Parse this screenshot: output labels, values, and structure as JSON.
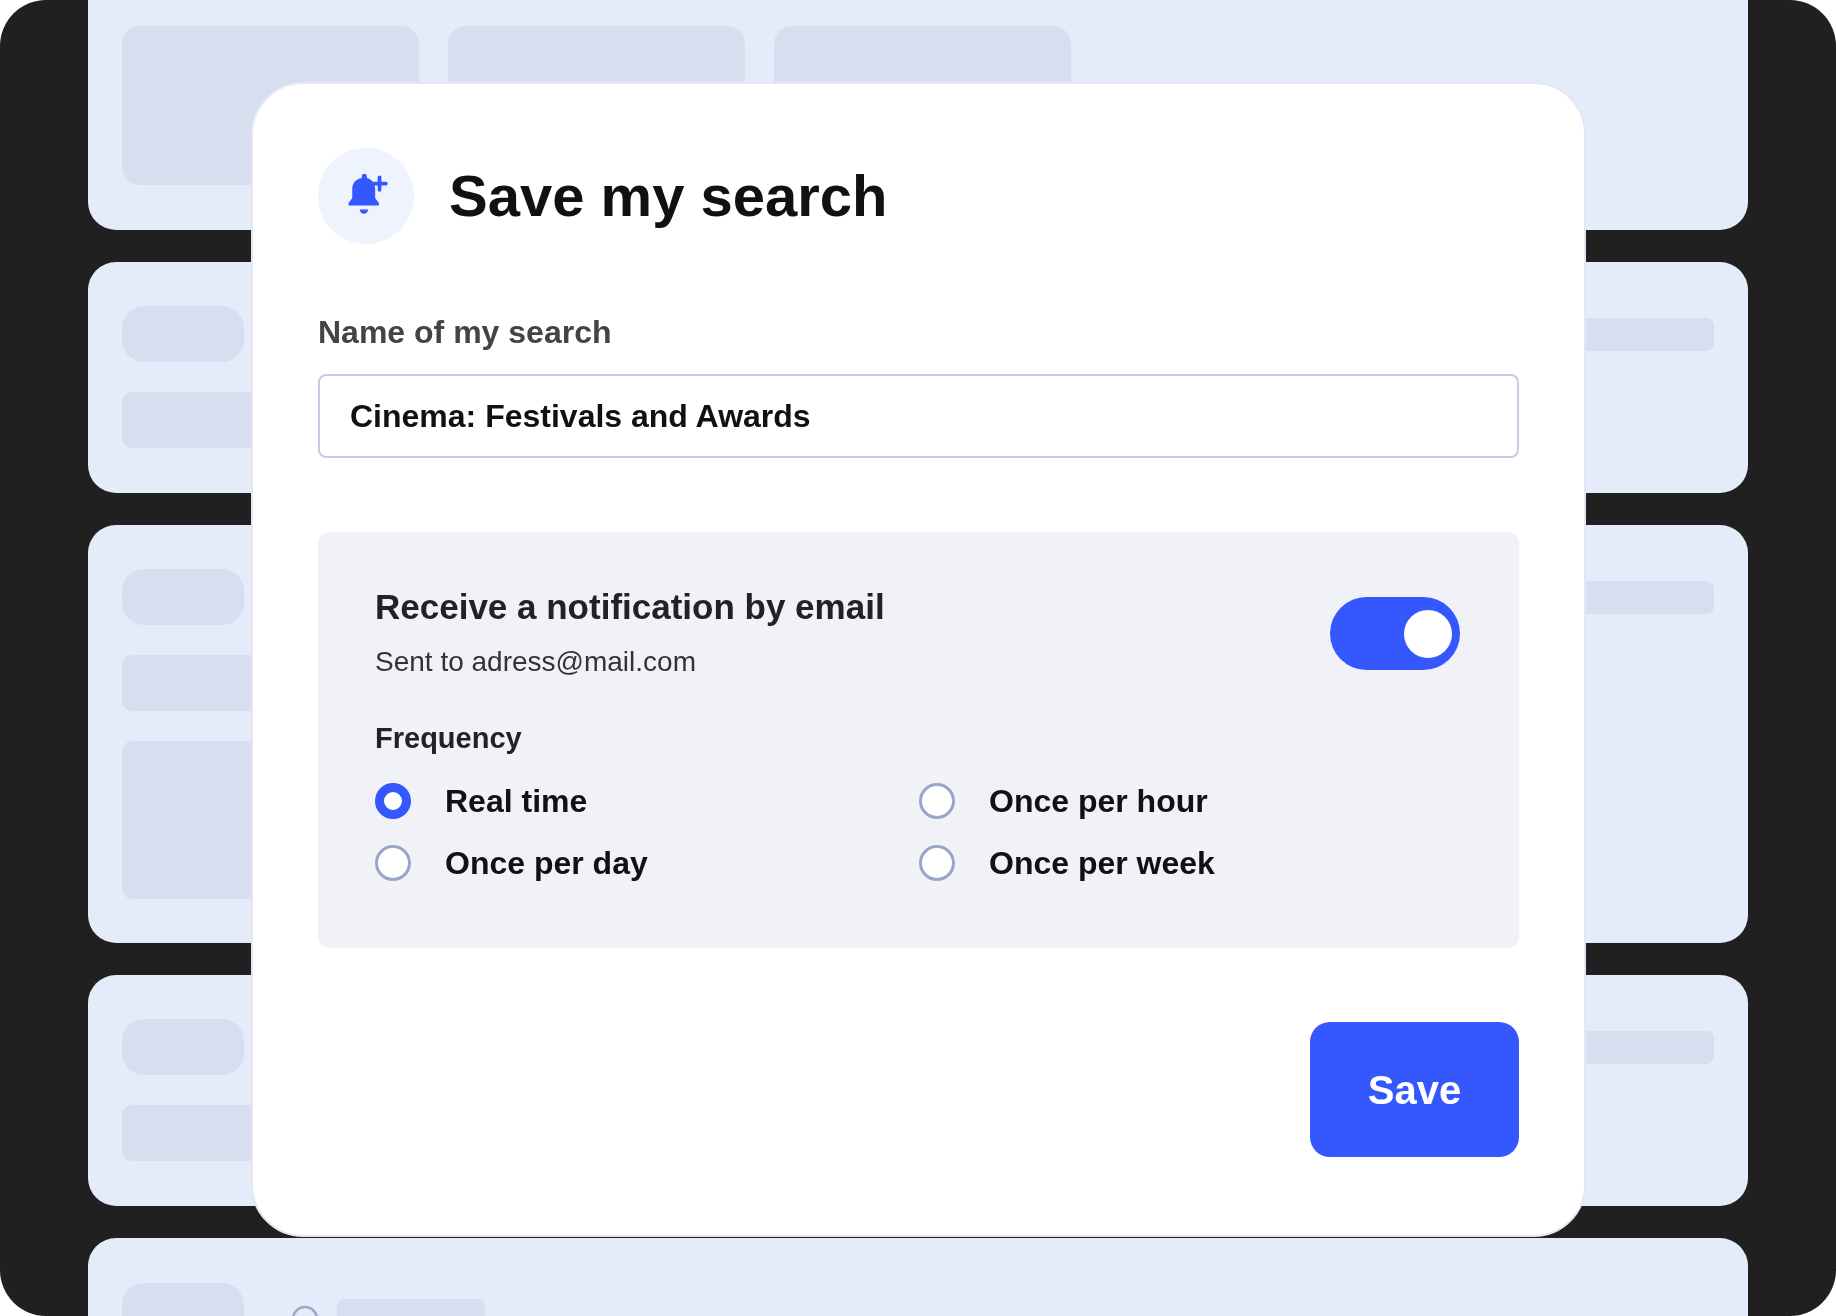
{
  "dialog": {
    "title": "Save my search",
    "name_field": {
      "label": "Name of my search",
      "value": "Cinema: Festivals and Awards"
    },
    "notification": {
      "title": "Receive a notification by email",
      "subtitle": "Sent to adress@mail.com",
      "on": true,
      "frequency_label": "Frequency",
      "options": [
        {
          "label": "Real time",
          "selected": true
        },
        {
          "label": "Once per hour",
          "selected": false
        },
        {
          "label": "Once per day",
          "selected": false
        },
        {
          "label": "Once per week",
          "selected": false
        }
      ]
    },
    "save_button": "Save"
  }
}
